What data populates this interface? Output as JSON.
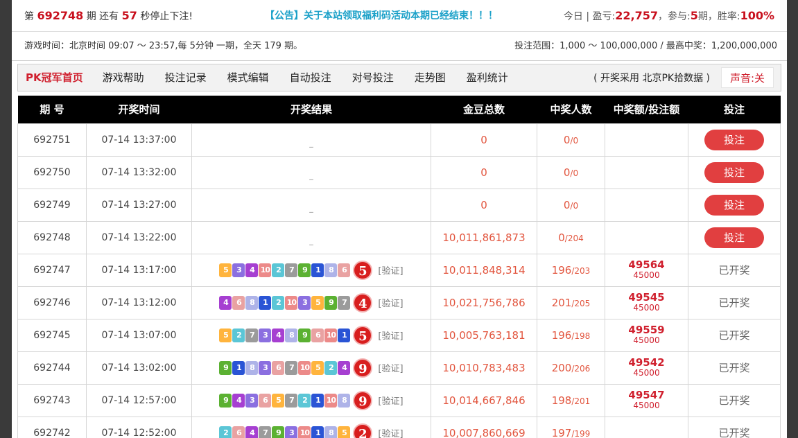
{
  "header": {
    "prefix": "第",
    "period": "692748",
    "mid1": "期 还有",
    "seconds": "57",
    "mid2": "秒停止下注!",
    "notice": "【公告】关于本站领取福利码活动本期已经结束！！！",
    "right_prefix": "今日 | 盈亏:",
    "profit": "22,757",
    "right_mid": "，参与:",
    "joined": "5",
    "right_mid2": "期，胜率:",
    "rate": "100%"
  },
  "info": {
    "left": "游戏时间：北京时间 09:07 ～ 23:57,每 5分钟 一期，全天 179 期。",
    "right": "投注范围：1,000 ～ 100,000,000 / 最高中奖：1,200,000,000"
  },
  "nav": {
    "items": [
      "PK冠军首页",
      "游戏帮助",
      "投注记录",
      "模式编辑",
      "自动投注",
      "对号投注",
      "走势图",
      "盈利统计"
    ],
    "source": "( 开奖采用 北京PK拾数据 )",
    "sound": "声音:关"
  },
  "table": {
    "headers": [
      "期 号",
      "开奖时间",
      "开奖结果",
      "金豆总数",
      "中奖人数",
      "中奖额/投注额",
      "投注"
    ],
    "verify_label": "[验证]",
    "dash": "_",
    "bet_label": "投注",
    "done_label": "已开奖",
    "rows": [
      {
        "period": "692751",
        "time": "07-14 13:37:00",
        "balls": [],
        "sum": "",
        "total": "0",
        "win": "0",
        "all": "/0",
        "prize": "",
        "bet": "",
        "status": "bet"
      },
      {
        "period": "692750",
        "time": "07-14 13:32:00",
        "balls": [],
        "sum": "",
        "total": "0",
        "win": "0",
        "all": "/0",
        "prize": "",
        "bet": "",
        "status": "bet"
      },
      {
        "period": "692749",
        "time": "07-14 13:27:00",
        "balls": [],
        "sum": "",
        "total": "0",
        "win": "0",
        "all": "/0",
        "prize": "",
        "bet": "",
        "status": "bet"
      },
      {
        "period": "692748",
        "time": "07-14 13:22:00",
        "balls": [],
        "sum": "",
        "total": "10,011,861,873",
        "win": "0",
        "all": "/204",
        "prize": "",
        "bet": "",
        "status": "bet"
      },
      {
        "period": "692747",
        "time": "07-14 13:17:00",
        "balls": [
          "5",
          "3",
          "4",
          "10",
          "2",
          "7",
          "9",
          "1",
          "8",
          "6"
        ],
        "sum": "5",
        "total": "10,011,848,314",
        "win": "196",
        "all": "/203",
        "prize": "49564",
        "bet": "45000",
        "status": "done"
      },
      {
        "period": "692746",
        "time": "07-14 13:12:00",
        "balls": [
          "4",
          "6",
          "8",
          "1",
          "2",
          "10",
          "3",
          "5",
          "9",
          "7"
        ],
        "sum": "4",
        "total": "10,021,756,786",
        "win": "201",
        "all": "/205",
        "prize": "49545",
        "bet": "45000",
        "status": "done"
      },
      {
        "period": "692745",
        "time": "07-14 13:07:00",
        "balls": [
          "5",
          "2",
          "7",
          "3",
          "4",
          "8",
          "9",
          "6",
          "10",
          "1"
        ],
        "sum": "5",
        "total": "10,005,763,181",
        "win": "196",
        "all": "/198",
        "prize": "49559",
        "bet": "45000",
        "status": "done"
      },
      {
        "period": "692744",
        "time": "07-14 13:02:00",
        "balls": [
          "9",
          "1",
          "8",
          "3",
          "6",
          "7",
          "10",
          "5",
          "2",
          "4"
        ],
        "sum": "9",
        "total": "10,010,783,483",
        "win": "200",
        "all": "/206",
        "prize": "49542",
        "bet": "45000",
        "status": "done"
      },
      {
        "period": "692743",
        "time": "07-14 12:57:00",
        "balls": [
          "9",
          "4",
          "3",
          "6",
          "5",
          "7",
          "2",
          "1",
          "10",
          "8"
        ],
        "sum": "9",
        "total": "10,014,667,846",
        "win": "198",
        "all": "/201",
        "prize": "49547",
        "bet": "45000",
        "status": "done"
      },
      {
        "period": "692742",
        "time": "07-14 12:52:00",
        "balls": [
          "2",
          "6",
          "4",
          "7",
          "9",
          "3",
          "10",
          "1",
          "8",
          "5"
        ],
        "sum": "2",
        "total": "10,007,860,669",
        "win": "197",
        "all": "/199",
        "prize": "",
        "bet": "",
        "status": "done"
      }
    ]
  },
  "ball_colors": {
    "1": "#2a54d5",
    "2": "#5bc6d6",
    "3": "#8b6fe0",
    "4": "#a63fd1",
    "5": "#ffb43d",
    "6": "#e9a2a2",
    "7": "#9b9b9b",
    "8": "#aeb3e8",
    "9": "#5bb132",
    "10": "#ec8a89"
  }
}
